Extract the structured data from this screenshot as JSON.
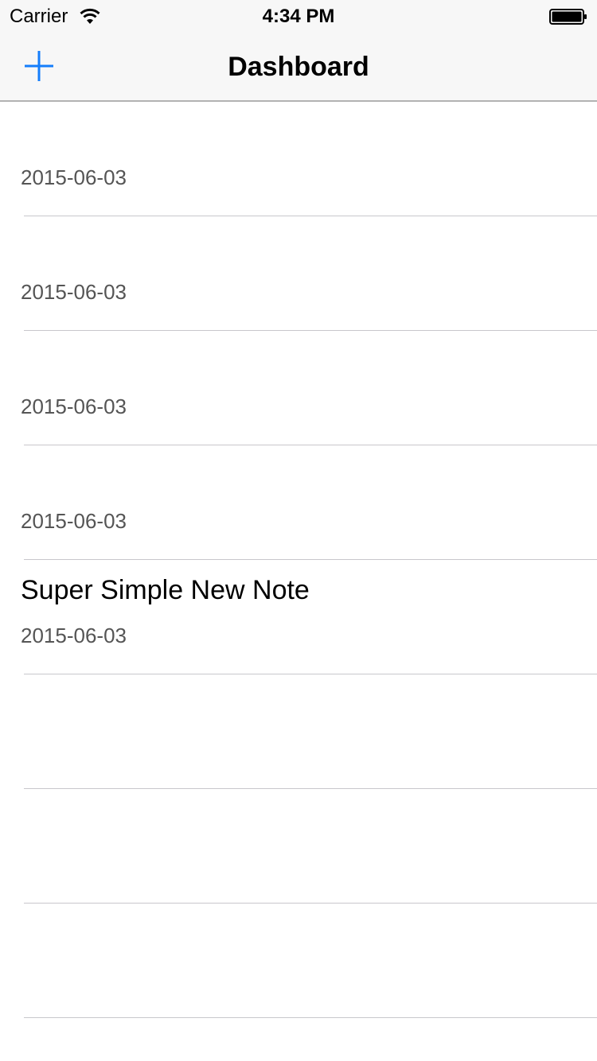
{
  "status_bar": {
    "carrier": "Carrier",
    "time": "4:34 PM"
  },
  "nav": {
    "title": "Dashboard",
    "add_icon": "plus-icon"
  },
  "colors": {
    "accent": "#157efb",
    "separator": "#c8c7cc",
    "subtitle": "#555555"
  },
  "notes": [
    {
      "title": "",
      "date": "2015-06-03"
    },
    {
      "title": "",
      "date": "2015-06-03"
    },
    {
      "title": "",
      "date": "2015-06-03"
    },
    {
      "title": "",
      "date": "2015-06-03"
    },
    {
      "title": "Super Simple New Note",
      "date": "2015-06-03"
    },
    {
      "title": "",
      "date": ""
    },
    {
      "title": "",
      "date": ""
    },
    {
      "title": "",
      "date": ""
    }
  ]
}
